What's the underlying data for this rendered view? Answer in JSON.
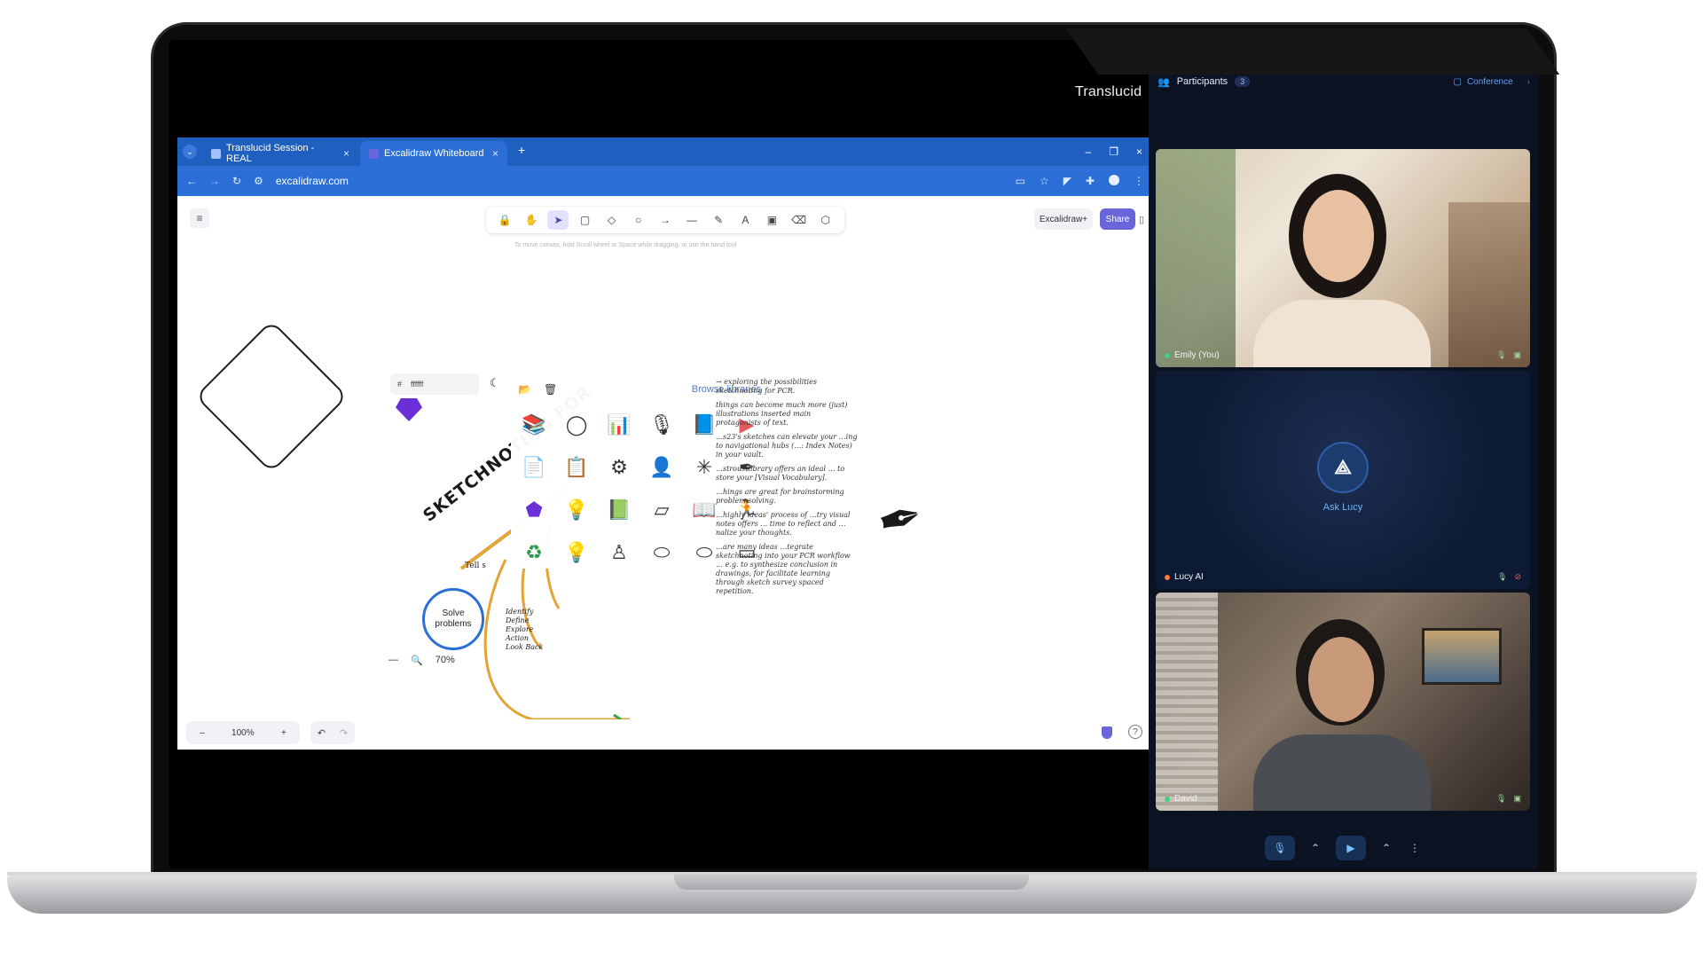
{
  "app": {
    "title": "Translucid"
  },
  "browser": {
    "tabs": [
      {
        "label": "Translucid Session - REAL",
        "close": "×"
      },
      {
        "label": "Excalidraw Whiteboard",
        "close": "×"
      }
    ],
    "new_tab": "+",
    "url": "excalidraw.com",
    "window_controls": [
      "–",
      "❐",
      "×"
    ]
  },
  "excalidraw": {
    "hint": "To move canvas, hold Scroll wheel or Space while dragging, or use the hand tool",
    "excalidraw_plus": "Excalidraw+",
    "share": "Share",
    "zoom": {
      "minus": "–",
      "value": "100%",
      "plus": "+"
    },
    "undo": "↶",
    "redo": "↷",
    "help": "?",
    "tools": [
      "🔒",
      "✋",
      "➤",
      "▢",
      "◇",
      "○",
      "→",
      "—",
      "✎",
      "A",
      "▣",
      "⌫",
      "⬡"
    ],
    "menu": "≡"
  },
  "sketch": {
    "color_hash": "#",
    "color_value": "ffffff",
    "title": "SKETCHNOTING FOR",
    "browse_libraries": "Browse libraries",
    "tell": "Tell s",
    "solve": "Solve problems",
    "steps": [
      "Identify",
      "Define",
      "Explore",
      "Action",
      "Look Back"
    ],
    "notes": [
      "→ exploring the possibilities sketchnoting for PCR.",
      "things can become much more (just) illustrations inserted main protagonists of text.",
      "…s23's sketches can elevate your …ing to navigational hubs (…: Index Notes) in your vault.",
      "…stroustlibrary offers an ideal … to store your [Visual Vocabulary].",
      "…hings are great for brainstorming problem solving.",
      "…highly ideas' process of …try visual notes offers … time to reflect and …nalize your thoughts.",
      "…are many ideas …tegrate sketchnoting into your PCR workflow … e.g. to synthesize conclusion in drawings, for facilitate learning through sketch survey spaced repetition."
    ],
    "inner_zoom": "70%"
  },
  "participants": {
    "title": "Participants",
    "count": "3",
    "conference": "Conference",
    "people": [
      {
        "name": "Emily (You)",
        "status_color": "#3fd07a"
      },
      {
        "name": "Lucy AI",
        "status_color": "#ff7a3d",
        "label": "Ask Lucy"
      },
      {
        "name": "David",
        "status_color": "#3fd07a"
      }
    ]
  },
  "colors": {
    "accent": "#6965db",
    "browser_blue": "#2b6fd6",
    "sidebar": "#0b1222"
  }
}
